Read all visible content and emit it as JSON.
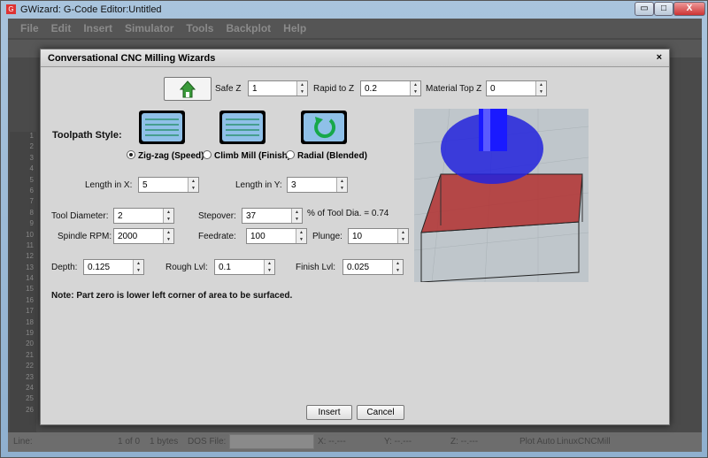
{
  "window": {
    "title": "GWizard: G-Code Editor:Untitled",
    "min": "▭",
    "max": "□",
    "close": "X"
  },
  "menu": [
    "File",
    "Edit",
    "Insert",
    "Simulator",
    "Tools",
    "Backplot",
    "Help"
  ],
  "gutter_lines": [
    "1",
    "2",
    "3",
    "4",
    "5",
    "6",
    "7",
    "8",
    "9",
    "10",
    "11",
    "12",
    "13",
    "14",
    "15",
    "16",
    "17",
    "18",
    "19",
    "20",
    "21",
    "22",
    "23",
    "24",
    "25",
    "26"
  ],
  "status": {
    "line": "Line:",
    "pos": "1 of 0",
    "bytes": "1 bytes",
    "dos": "DOS File:",
    "x": "X: --.---",
    "y": "Y: --.---",
    "z": "Z: --.---",
    "plot": "Plot Auto",
    "machine": "LinuxCNCMill"
  },
  "dialog": {
    "title": "Conversational CNC Milling Wizards",
    "close": "×",
    "safe_z": {
      "label": "Safe Z",
      "value": "1"
    },
    "rapid_z": {
      "label": "Rapid to Z",
      "value": "0.2"
    },
    "mat_top": {
      "label": "Material Top Z",
      "value": "0"
    },
    "toolpath_label": "Toolpath Style:",
    "styles": [
      "Zig-zag (Speed)",
      "Climb Mill (Finish)",
      "Radial (Blended)"
    ],
    "selected_style": "Zig-zag (Speed)",
    "len_x": {
      "label": "Length in X:",
      "value": "5"
    },
    "len_y": {
      "label": "Length in Y:",
      "value": "3"
    },
    "tool_dia": {
      "label": "Tool Diameter:",
      "value": "2"
    },
    "stepover": {
      "label": "Stepover:",
      "value": "37",
      "note": "% of Tool Dia. = 0.74"
    },
    "rpm": {
      "label": "Spindle RPM:",
      "value": "2000"
    },
    "feed": {
      "label": "Feedrate:",
      "value": "100"
    },
    "plunge": {
      "label": "Plunge:",
      "value": "10"
    },
    "depth": {
      "label": "Depth:",
      "value": "0.125"
    },
    "rough": {
      "label": "Rough Lvl:",
      "value": "0.1"
    },
    "finish": {
      "label": "Finish Lvl:",
      "value": "0.025"
    },
    "note": "Note:  Part zero is lower left corner of area to be surfaced.",
    "insert": "Insert",
    "cancel": "Cancel"
  }
}
